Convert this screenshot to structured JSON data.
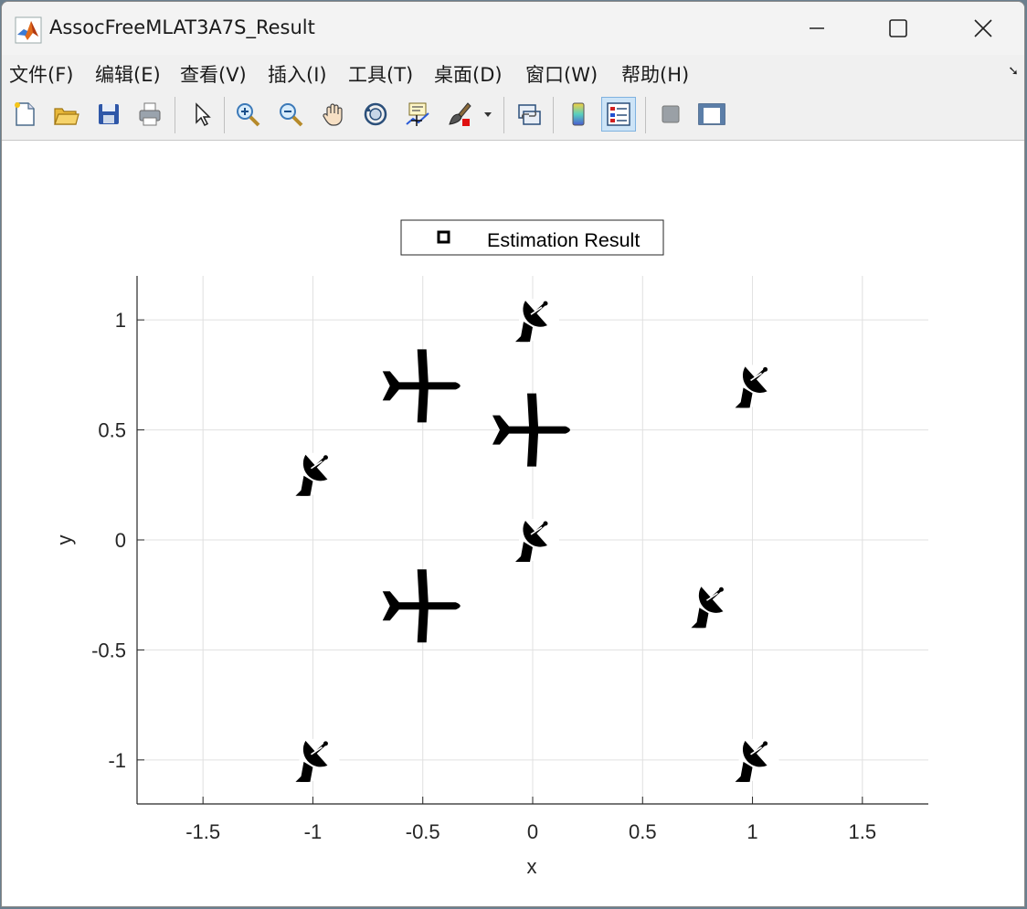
{
  "window": {
    "title": "AssocFreeMLAT3A7S_Result"
  },
  "menu": [
    {
      "label": "文件(F)"
    },
    {
      "label": "编辑(E)"
    },
    {
      "label": "查看(V)"
    },
    {
      "label": "插入(I)"
    },
    {
      "label": "工具(T)"
    },
    {
      "label": "桌面(D)"
    },
    {
      "label": "窗口(W)"
    },
    {
      "label": "帮助(H)"
    }
  ],
  "toolbar": {
    "buttons": [
      {
        "icon": "new-figure-icon"
      },
      {
        "icon": "open-file-icon"
      },
      {
        "icon": "save-icon"
      },
      {
        "icon": "print-icon"
      },
      {
        "icon": "edit-plot-pointer-icon"
      },
      {
        "icon": "zoom-in-icon"
      },
      {
        "icon": "zoom-out-icon"
      },
      {
        "icon": "pan-hand-icon"
      },
      {
        "icon": "rotate-3d-icon"
      },
      {
        "icon": "data-cursor-icon"
      },
      {
        "icon": "brush-icon"
      },
      {
        "icon": "link-plot-icon"
      },
      {
        "icon": "colorbar-icon"
      },
      {
        "icon": "legend-icon",
        "active": true
      },
      {
        "icon": "hide-plot-tools-icon"
      },
      {
        "icon": "show-plot-tools-icon"
      }
    ]
  },
  "chart_data": {
    "type": "scatter",
    "title": "",
    "xlabel": "x",
    "ylabel": "y",
    "xlim": [
      -1.8,
      1.8
    ],
    "ylim": [
      -1.2,
      1.2
    ],
    "xticks": [
      "-1.5",
      "-1",
      "-0.5",
      "0",
      "0.5",
      "1",
      "1.5"
    ],
    "xtick_values": [
      -1.5,
      -1,
      -0.5,
      0,
      0.5,
      1,
      1.5
    ],
    "yticks": [
      "1",
      "0.5",
      "0",
      "-0.5",
      "-1"
    ],
    "ytick_values": [
      1,
      0.5,
      0,
      -0.5,
      -1
    ],
    "grid": true,
    "legend": {
      "position": "top-center",
      "entries": [
        {
          "label": "Estimation Result",
          "marker": "square"
        }
      ]
    },
    "series": [
      {
        "marker": "antenna",
        "x": [
          0,
          1,
          -1,
          0,
          0.8,
          -1,
          1
        ],
        "y": [
          1,
          0.7,
          0.3,
          0,
          -0.3,
          -1,
          -1
        ]
      },
      {
        "marker": "airplane",
        "x": [
          -0.5,
          0,
          -0.5
        ],
        "y": [
          0.7,
          0.5,
          -0.3
        ]
      },
      {
        "name": "Estimation Result",
        "marker": "square",
        "x": [],
        "y": []
      }
    ],
    "colors": {
      "markers": "#000000",
      "grid": "#e0e0e0",
      "axes": "#262626"
    }
  }
}
